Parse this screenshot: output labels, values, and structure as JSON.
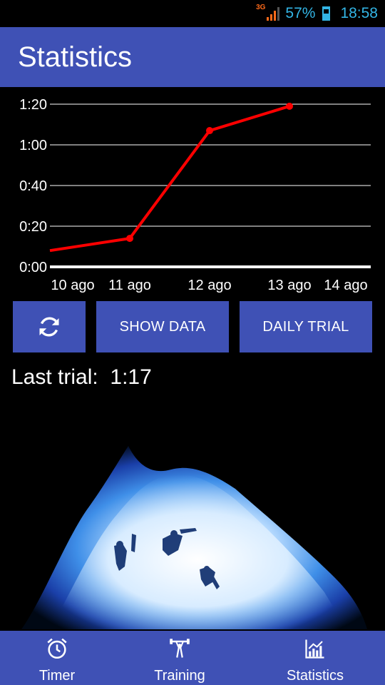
{
  "status_bar": {
    "network": "3G",
    "battery": "57%",
    "time": "18:58"
  },
  "app_bar": {
    "title": "Statistics"
  },
  "chart_data": {
    "type": "line",
    "x": [
      "10 ago",
      "11 ago",
      "12 ago",
      "13 ago",
      "14 ago"
    ],
    "y_tick_labels": [
      "0:00",
      "0:20",
      "0:40",
      "1:00",
      "1:20"
    ],
    "y_ticks_seconds": [
      0,
      20,
      40,
      60,
      80
    ],
    "ylim_seconds": [
      0,
      80
    ],
    "series": [
      {
        "color": "#ff0000",
        "points": [
          {
            "x": "10 ago",
            "y_seconds": 8
          },
          {
            "x": "11 ago",
            "y_seconds": 14
          },
          {
            "x": "12 ago",
            "y_seconds": 67
          },
          {
            "x": "13 ago",
            "y_seconds": 79
          }
        ]
      }
    ],
    "grid": true
  },
  "buttons": {
    "refresh_icon": "refresh-icon",
    "show_data": "SHOW DATA",
    "daily_trial": "DAILY TRIAL"
  },
  "last_trial": {
    "label": "Last trial:",
    "value": "1:17"
  },
  "bottom_nav": {
    "items": [
      {
        "label": "Timer",
        "icon": "alarm-clock-icon"
      },
      {
        "label": "Training",
        "icon": "weightlifter-icon"
      },
      {
        "label": "Statistics",
        "icon": "chart-icon"
      }
    ]
  },
  "colors": {
    "primary": "#3f51b5",
    "line": "#ff0000",
    "status_text": "#33b5e5",
    "network": "#ff6a1a"
  }
}
